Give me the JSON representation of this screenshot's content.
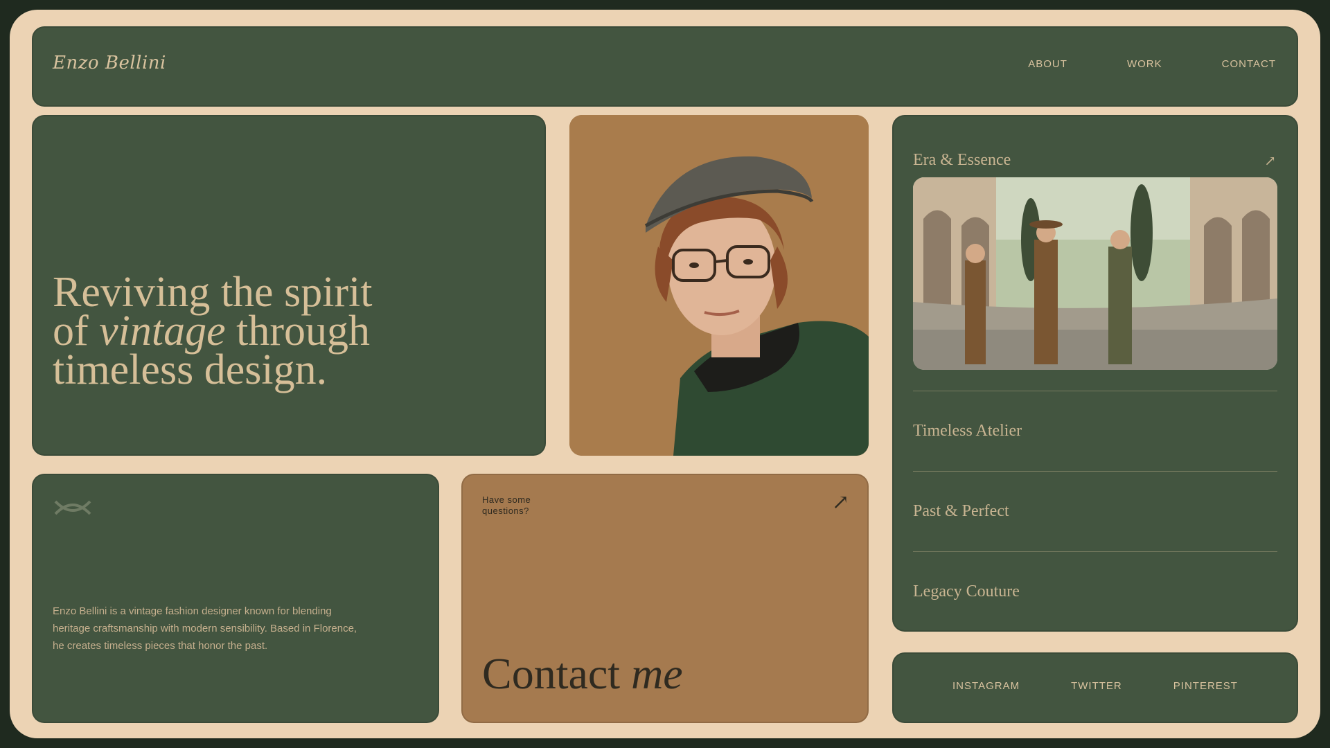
{
  "header": {
    "logo": "Enzo Bellini",
    "nav": [
      "ABOUT",
      "WORK",
      "CONTACT"
    ]
  },
  "hero": {
    "line1": "Reviving the spirit",
    "line2_pre": "of ",
    "line2_em": "vintage",
    "line2_post": " through",
    "line3": "timeless design."
  },
  "projects": {
    "items": [
      "Era & Essence",
      "Timeless Atelier",
      "Past & Perfect",
      "Legacy Couture"
    ]
  },
  "about": {
    "text": "Enzo Bellini is a vintage fashion designer known for blending heritage craftsmanship with modern sensibility. Based in Florence, he creates timeless pieces that honor the past."
  },
  "contact": {
    "label_line1": "Have some",
    "label_line2": "questions?",
    "title": "Contact",
    "title_em": "me"
  },
  "socials": [
    "INSTAGRAM",
    "TWITTER",
    "PINTEREST"
  ],
  "icons": {
    "project_arrow": "arrow-up-right-icon",
    "contact_arrow": "arrow-up-right-icon",
    "about_icon": "infinity-knot-icon"
  },
  "colors": {
    "frame": "#ecd3b4",
    "green": "#435540",
    "tan": "#a57a4f",
    "text_light": "#d9c39f"
  }
}
